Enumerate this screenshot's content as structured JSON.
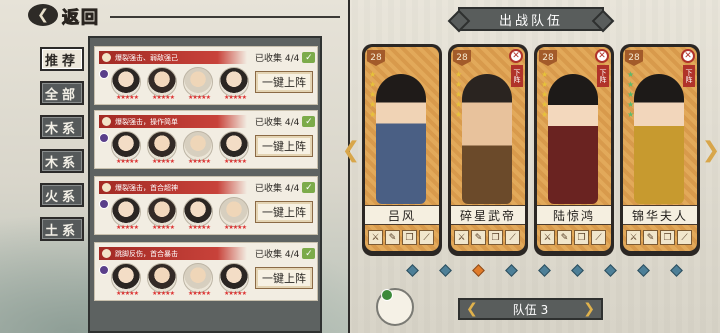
{
  "header": {
    "back_label": "返回"
  },
  "filters": [
    "推荐",
    "全部",
    "木系",
    "木系",
    "火系",
    "土系"
  ],
  "teams": [
    {
      "tag": "爆裂强击、弱敌强己",
      "collected": "已收集 4/4",
      "action": "一键上阵"
    },
    {
      "tag": "爆裂强击，操作简单",
      "collected": "已收集 4/4",
      "action": "一键上阵"
    },
    {
      "tag": "爆裂强击，首合超神",
      "collected": "已收集 4/4",
      "action": "一键上阵"
    },
    {
      "tag": "跳脚反伤，首合暴击",
      "collected": "已收集 4/4",
      "action": "一键上阵"
    }
  ],
  "lineup": {
    "title": "出战队伍",
    "remove_label": "下阵",
    "heroes": [
      {
        "name": "吕风",
        "level": "28"
      },
      {
        "name": "碎星武帝",
        "level": "28"
      },
      {
        "name": "陆惊鸿",
        "level": "28"
      },
      {
        "name": "锦华夫人",
        "level": "28"
      }
    ],
    "team_selector": "队伍 3",
    "page_count": 9,
    "page_active": 3
  }
}
